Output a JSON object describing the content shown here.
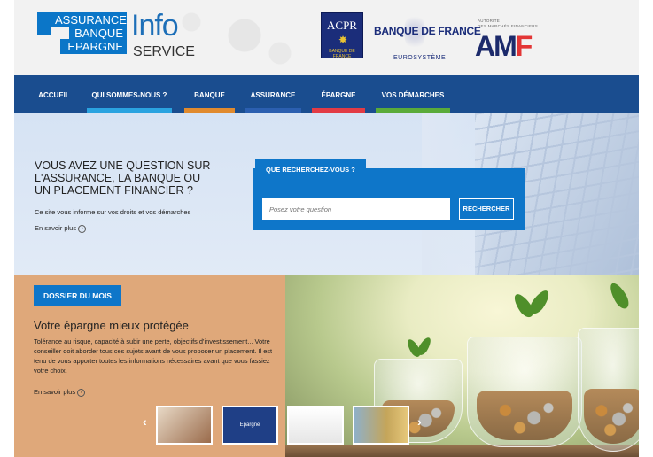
{
  "header": {
    "logo": {
      "line1": "ASSURANCE",
      "line2": "BANQUE",
      "line3": "EPARGNE",
      "info": "Info",
      "service": "SERVICE"
    },
    "acpr": {
      "title": "ACPR",
      "subtitle": "BANQUE DE FRANCE"
    },
    "bdf": {
      "title": "BANQUE DE FRANCE",
      "subtitle": "EUROSYSTÈME"
    },
    "amf": {
      "top_line1": "AUTORITÉ",
      "top_line2": "DES MARCHÉS FINANCIERS",
      "logo_main": "AM",
      "logo_f": "F"
    }
  },
  "nav": {
    "items": [
      {
        "label": "ACCUEIL",
        "underline": ""
      },
      {
        "label": "QUI SOMMES-NOUS ?",
        "underline": "#2aa3e0"
      },
      {
        "label": "BANQUE",
        "underline": "#e08a2e"
      },
      {
        "label": "ASSURANCE",
        "underline": "#2b5fb0"
      },
      {
        "label": "ÉPARGNE",
        "underline": "#e23b45"
      },
      {
        "label": "VOS DÉMARCHES",
        "underline": "#5aab3a"
      }
    ]
  },
  "hero": {
    "title": "VOUS AVEZ UNE QUESTION SUR L'ASSURANCE, LA BANQUE OU UN PLACEMENT FINANCIER ?",
    "subtitle": "Ce site vous informe sur vos droits et vos démarches",
    "more": "En savoir plus",
    "search": {
      "tab": "QUE RECHERCHEZ-VOUS ?",
      "placeholder": "Posez votre question",
      "button": "RECHERCHER"
    }
  },
  "dossier": {
    "badge": "DOSSIER DU MOIS",
    "title": "Votre épargne mieux protégée",
    "text": "Tolérance au risque, capacité à subir une perte, objectifs d'investissement... Votre conseiller doit aborder tous ces sujets avant de vous proposer un placement. Il est tenu de vous apporter toutes les informations nécessaires avant que vous fassiez votre choix.",
    "more": "En savoir plus"
  },
  "carousel": {
    "thumb2_label": "Epargne",
    "prev": "‹",
    "next": "›"
  },
  "colors": {
    "nav_bg": "#1a4d8f",
    "accent_blue": "#0e76c9",
    "dossier_bg": "#dfa87a"
  }
}
